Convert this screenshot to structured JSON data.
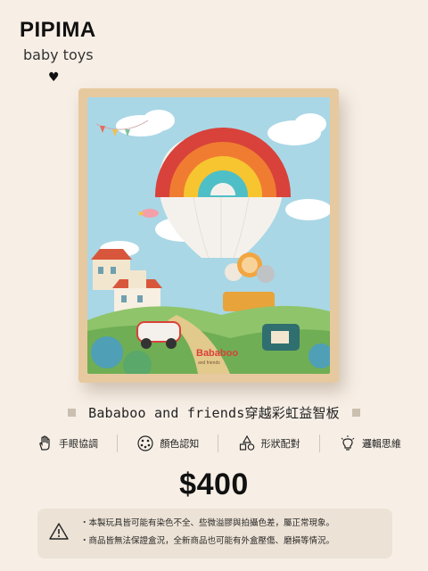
{
  "brand": {
    "title": "PIPIMA",
    "subtitle": "baby toys"
  },
  "product": {
    "title": "Bababoo and friends穿越彩虹益智板",
    "board_logo": "Bababoo",
    "board_logo_sub": "and friends"
  },
  "features": [
    {
      "label": "手眼協調",
      "icon": "hand-icon"
    },
    {
      "label": "顏色認知",
      "icon": "palette-icon"
    },
    {
      "label": "形狀配對",
      "icon": "shapes-icon"
    },
    {
      "label": "邏輯思維",
      "icon": "lightbulb-icon"
    }
  ],
  "price": "$400",
  "notice": {
    "lines": [
      "・本製玩具皆可能有染色不全、些微溢膠與拍攝色差，屬正常現象。",
      "・商品皆無法保證盒況，全新商品也可能有外盒壓傷、磨損等情況。"
    ]
  },
  "colors": {
    "background": "#f7efe6",
    "notice_bg": "#ece2d5",
    "text": "#222222"
  }
}
